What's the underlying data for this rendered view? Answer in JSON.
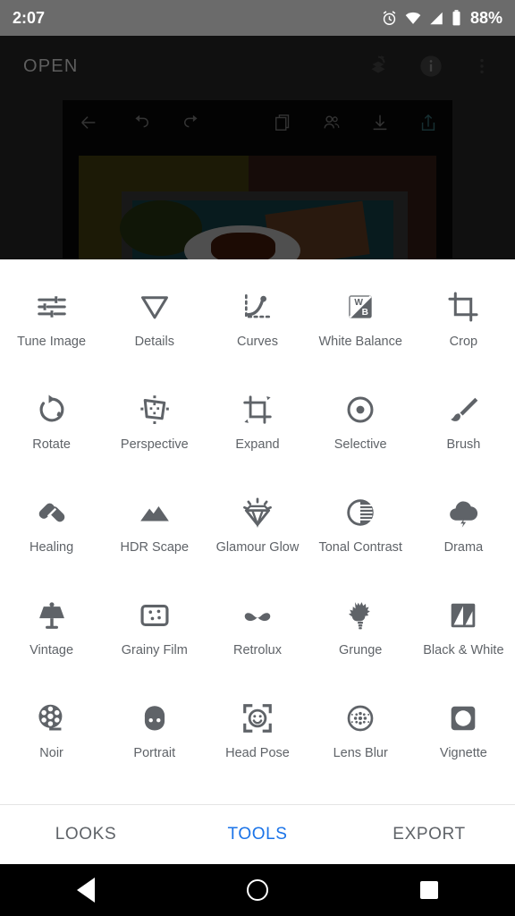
{
  "status_bar": {
    "time": "2:07",
    "battery_pct": "88%",
    "icons": [
      "alarm-icon",
      "wifi-icon",
      "signal-icon",
      "battery-icon"
    ]
  },
  "app_bar": {
    "title": "OPEN",
    "icons": [
      "layers-revert-icon",
      "info-icon",
      "overflow-menu-icon"
    ]
  },
  "editor_backdrop": {
    "icons": [
      "back-arrow-icon",
      "undo-icon",
      "redo-icon",
      "stacks-icon",
      "people-icon",
      "download-icon",
      "share-icon"
    ]
  },
  "tools": [
    {
      "label": "Tune Image",
      "icon": "tune-image-icon"
    },
    {
      "label": "Details",
      "icon": "details-icon"
    },
    {
      "label": "Curves",
      "icon": "curves-icon"
    },
    {
      "label": "White Balance",
      "icon": "white-balance-icon"
    },
    {
      "label": "Crop",
      "icon": "crop-icon"
    },
    {
      "label": "Rotate",
      "icon": "rotate-icon"
    },
    {
      "label": "Perspective",
      "icon": "perspective-icon"
    },
    {
      "label": "Expand",
      "icon": "expand-icon"
    },
    {
      "label": "Selective",
      "icon": "selective-icon"
    },
    {
      "label": "Brush",
      "icon": "brush-icon"
    },
    {
      "label": "Healing",
      "icon": "healing-icon"
    },
    {
      "label": "HDR Scape",
      "icon": "hdr-scape-icon"
    },
    {
      "label": "Glamour Glow",
      "icon": "glamour-glow-icon"
    },
    {
      "label": "Tonal Contrast",
      "icon": "tonal-contrast-icon"
    },
    {
      "label": "Drama",
      "icon": "drama-icon"
    },
    {
      "label": "Vintage",
      "icon": "vintage-icon"
    },
    {
      "label": "Grainy Film",
      "icon": "grainy-film-icon"
    },
    {
      "label": "Retrolux",
      "icon": "retrolux-icon"
    },
    {
      "label": "Grunge",
      "icon": "grunge-icon"
    },
    {
      "label": "Black & White",
      "icon": "black-white-icon"
    },
    {
      "label": "Noir",
      "icon": "noir-icon"
    },
    {
      "label": "Portrait",
      "icon": "portrait-icon"
    },
    {
      "label": "Head Pose",
      "icon": "head-pose-icon"
    },
    {
      "label": "Lens Blur",
      "icon": "lens-blur-icon"
    },
    {
      "label": "Vignette",
      "icon": "vignette-icon"
    }
  ],
  "tabs": [
    {
      "label": "LOOKS",
      "active": false
    },
    {
      "label": "TOOLS",
      "active": true
    },
    {
      "label": "EXPORT",
      "active": false
    }
  ],
  "nav_bar": {
    "back": "back-nav-icon",
    "home": "home-nav-icon",
    "recents": "recents-nav-icon"
  },
  "colors": {
    "accent": "#1a73e8",
    "icon_gray": "#5f6368",
    "sheet_bg": "#ffffff",
    "status_bar_bg": "#6b6b6b",
    "nav_bar_bg": "#000000"
  }
}
